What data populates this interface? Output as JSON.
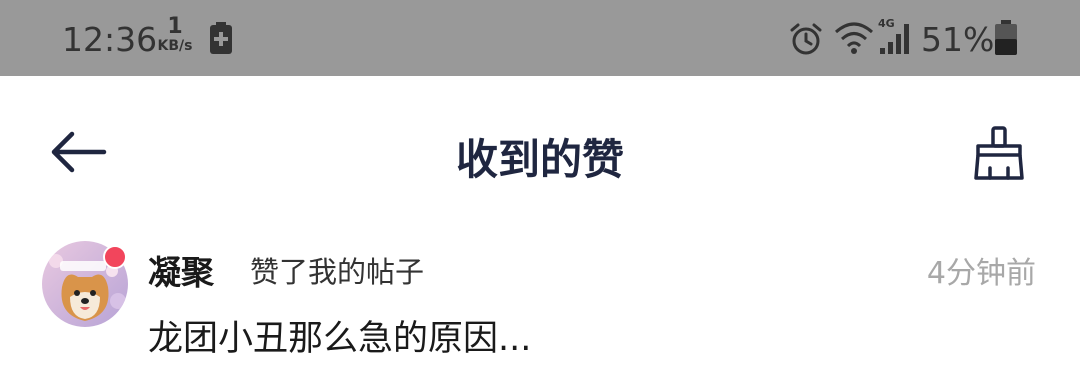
{
  "status_bar": {
    "time": "12:36",
    "net_speed_value": "1",
    "net_speed_unit": "KB/s",
    "network_type": "4G",
    "battery_percent": "51%"
  },
  "header": {
    "title": "收到的赞"
  },
  "notifications": [
    {
      "username": "凝聚",
      "action": "赞了我的帖子",
      "time": "4分钟前",
      "content": "龙团小丑那么急的原因..."
    }
  ],
  "colors": {
    "status_bar_bg": "#999999",
    "title": "#1f2640",
    "unread_dot": "#f2455c",
    "timestamp": "#a8a8a8"
  }
}
